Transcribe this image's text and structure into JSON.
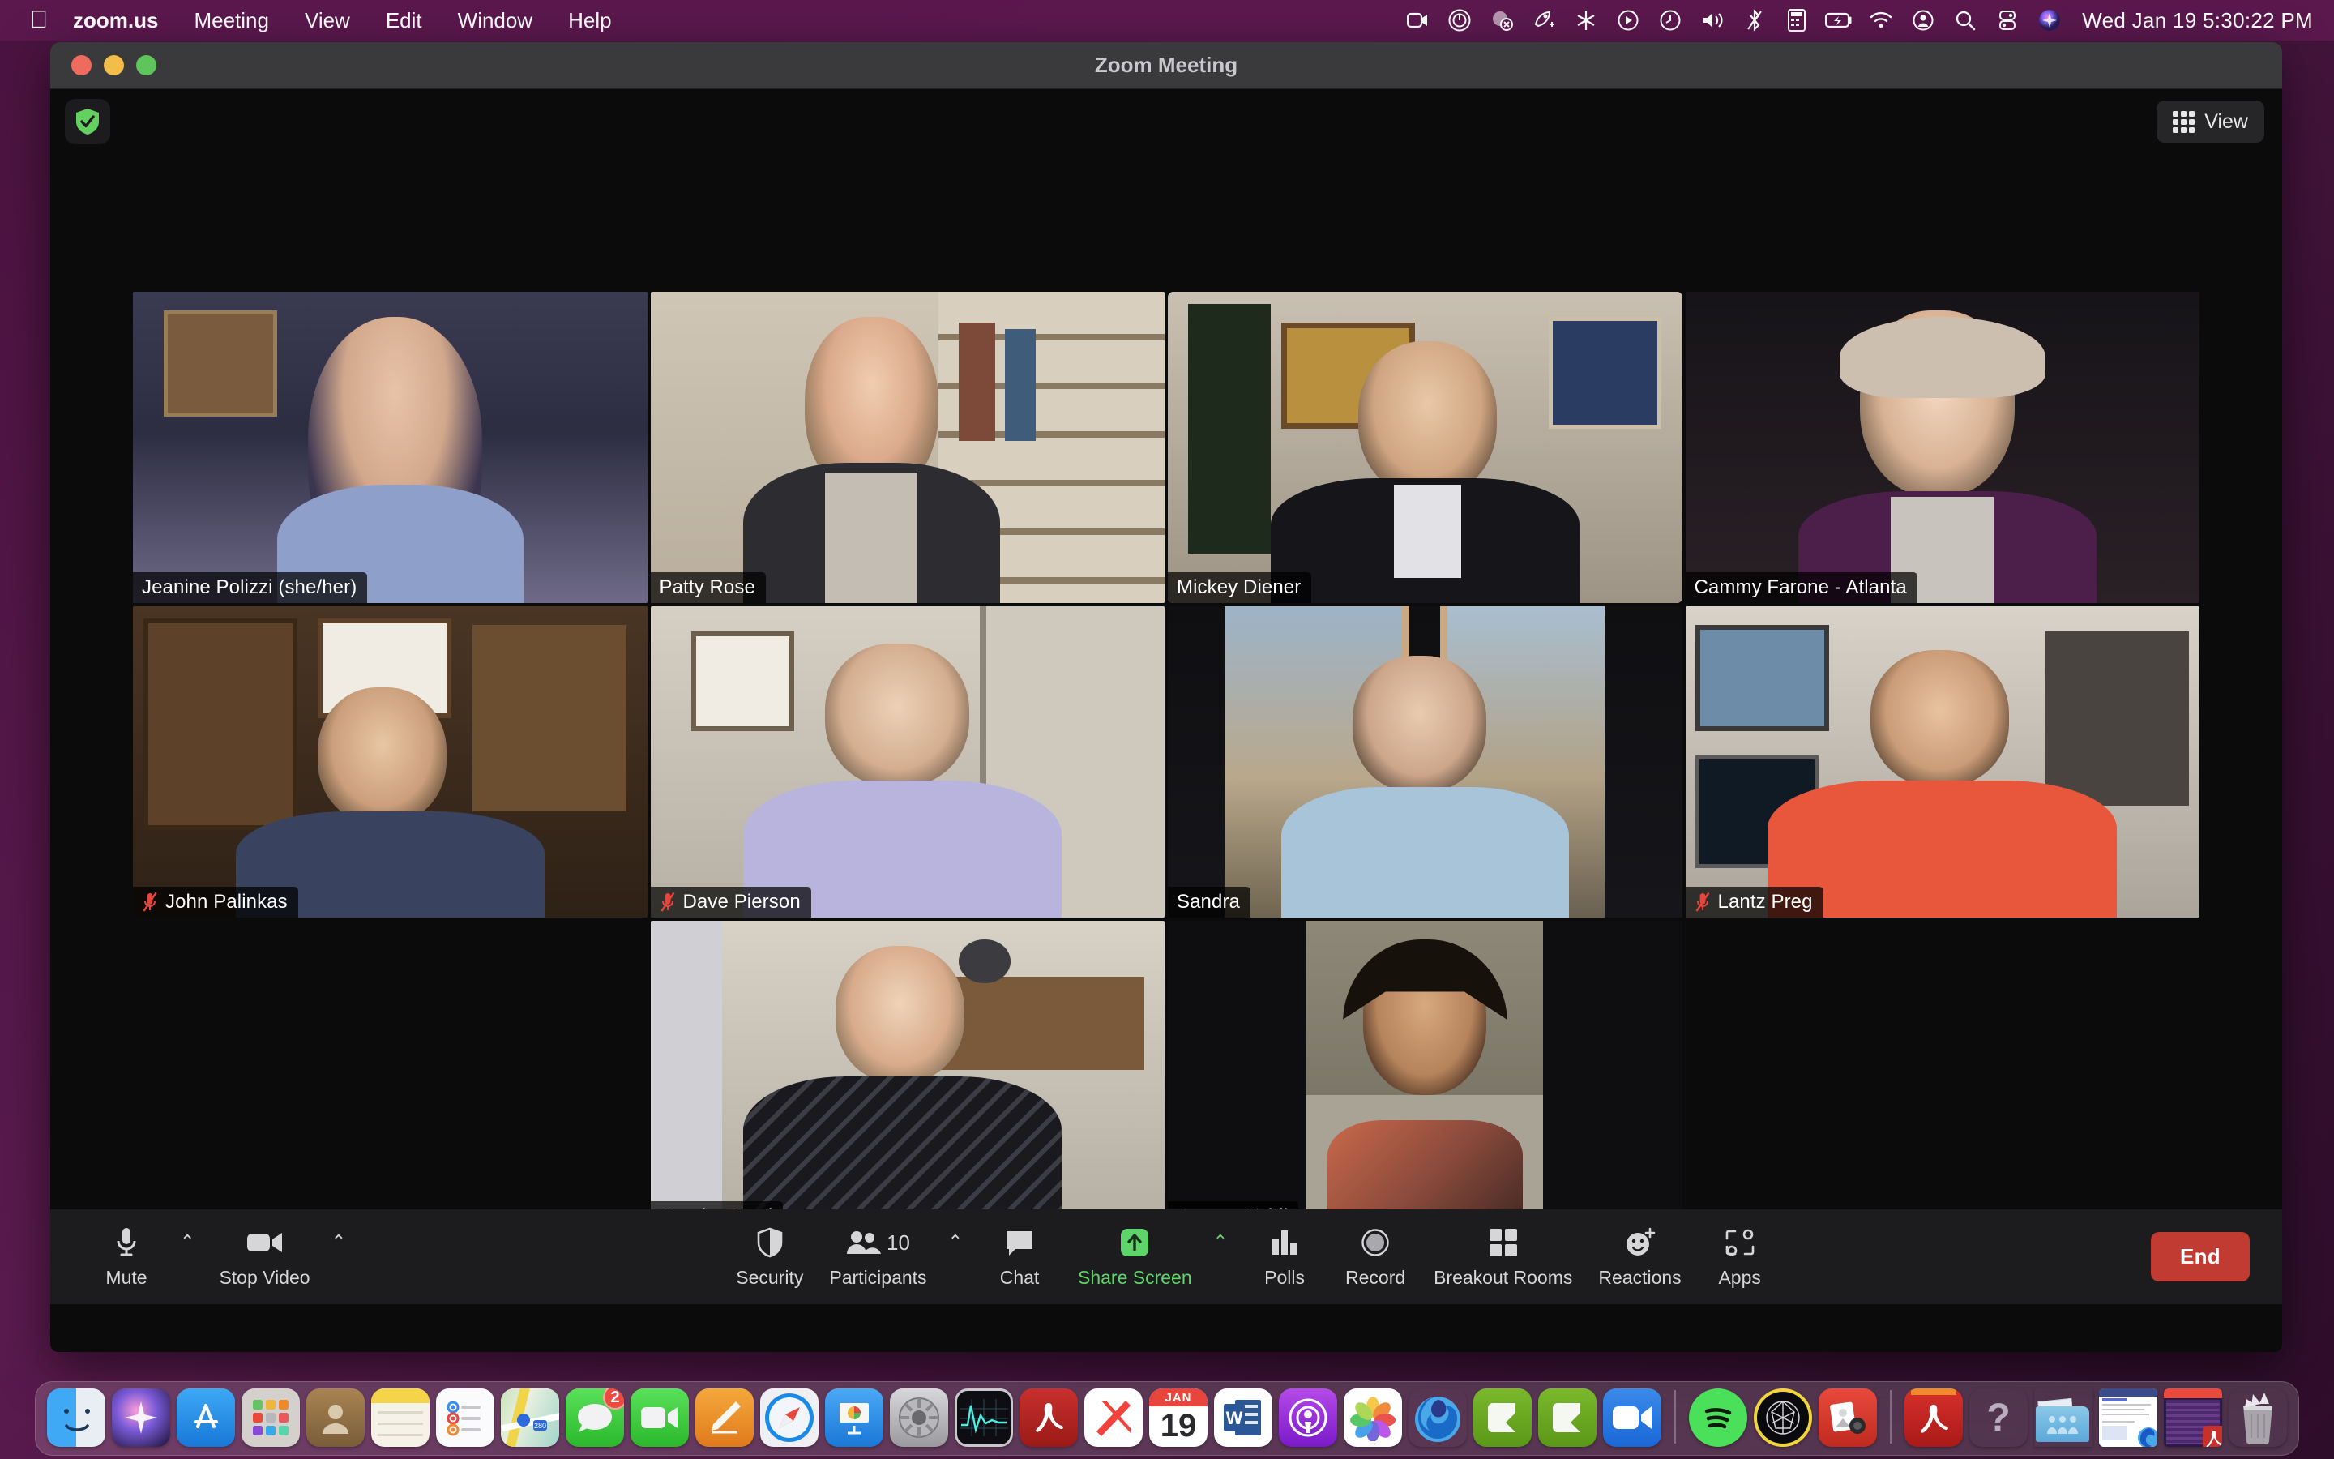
{
  "menubar": {
    "apple_icon": "apple-logo-icon",
    "items": [
      {
        "label": "zoom.us",
        "bold": true
      },
      {
        "label": "Meeting",
        "bold": false
      },
      {
        "label": "View",
        "bold": false
      },
      {
        "label": "Edit",
        "bold": false
      },
      {
        "label": "Window",
        "bold": false
      },
      {
        "label": "Help",
        "bold": false
      }
    ],
    "status_icons": [
      "screen-recording-icon",
      "zoom-record-circle-icon",
      "do-not-disturb-icon",
      "rocket-icon",
      "snowflake-icon",
      "play-circle-icon",
      "time-machine-icon",
      "volume-icon",
      "bluetooth-off-icon",
      "calculator-icon",
      "battery-charging-icon",
      "wifi-icon",
      "user-account-icon",
      "search-icon",
      "control-center-icon",
      "siri-icon"
    ],
    "clock": "Wed Jan 19 5:30:22 PM"
  },
  "window": {
    "title": "Zoom Meeting",
    "encryption_badge": "shield-check-icon",
    "view_button": {
      "label": "View",
      "icon": "grid-view-icon"
    }
  },
  "participants": [
    {
      "name": "Jeanine Polizzi (she/her)",
      "muted": false,
      "active_speaker": false,
      "row": 1
    },
    {
      "name": "Patty Rose",
      "muted": false,
      "active_speaker": false,
      "row": 1
    },
    {
      "name": "Mickey Diener",
      "muted": false,
      "active_speaker": true,
      "row": 1
    },
    {
      "name": "Cammy Farone - Atlanta",
      "muted": false,
      "active_speaker": false,
      "row": 1
    },
    {
      "name": "John Palinkas",
      "muted": true,
      "active_speaker": false,
      "row": 2
    },
    {
      "name": "Dave Pierson",
      "muted": true,
      "active_speaker": false,
      "row": 2
    },
    {
      "name": "Sandra",
      "muted": false,
      "active_speaker": false,
      "row": 2
    },
    {
      "name": "Lantz Preg",
      "muted": true,
      "active_speaker": false,
      "row": 2
    },
    {
      "name": "Carolyn Byrd",
      "muted": false,
      "active_speaker": false,
      "row": 3
    },
    {
      "name": "Seema Kohli",
      "muted": false,
      "active_speaker": false,
      "row": 3
    }
  ],
  "toolbar": {
    "mute": {
      "label": "Mute",
      "icon": "microphone-icon",
      "caret": "⌃"
    },
    "video": {
      "label": "Stop Video",
      "icon": "video-camera-icon",
      "caret": "⌃"
    },
    "security": {
      "label": "Security",
      "icon": "shield-icon"
    },
    "participants": {
      "label": "Participants",
      "icon": "people-icon",
      "count": "10",
      "caret": "⌃"
    },
    "chat": {
      "label": "Chat",
      "icon": "speech-bubble-icon"
    },
    "share": {
      "label": "Share Screen",
      "icon": "share-arrow-up-icon",
      "caret": "⌃",
      "color": "#5fd46a"
    },
    "polls": {
      "label": "Polls",
      "icon": "bar-chart-icon"
    },
    "record": {
      "label": "Record",
      "icon": "record-circle-icon"
    },
    "breakout": {
      "label": "Breakout Rooms",
      "icon": "four-squares-icon"
    },
    "reactions": {
      "label": "Reactions",
      "icon": "smiley-plus-icon"
    },
    "apps": {
      "label": "Apps",
      "icon": "apps-bracket-icon"
    },
    "end": {
      "label": "End",
      "color": "#c23b33"
    }
  },
  "dock": {
    "items": [
      {
        "name": "finder-icon",
        "running": true
      },
      {
        "name": "siri-icon",
        "running": false
      },
      {
        "name": "app-store-icon",
        "running": false
      },
      {
        "name": "launchpad-icon",
        "running": false
      },
      {
        "name": "contacts-icon",
        "running": false
      },
      {
        "name": "notes-icon",
        "running": false
      },
      {
        "name": "reminders-icon",
        "running": false
      },
      {
        "name": "maps-icon",
        "running": false
      },
      {
        "name": "messages-icon",
        "running": true,
        "badge": "2"
      },
      {
        "name": "facetime-icon",
        "running": false
      },
      {
        "name": "pages-icon",
        "running": false
      },
      {
        "name": "safari-icon",
        "running": false
      },
      {
        "name": "keynote-icon",
        "running": false
      },
      {
        "name": "system-preferences-icon",
        "running": true
      },
      {
        "name": "activity-monitor-icon",
        "running": false
      },
      {
        "name": "acrobat-reader-icon",
        "running": false
      },
      {
        "name": "news-icon",
        "running": false
      },
      {
        "name": "calendar-icon",
        "running": false,
        "month": "JAN",
        "day": "19"
      },
      {
        "name": "microsoft-word-icon",
        "running": false
      },
      {
        "name": "podcasts-icon",
        "running": false
      },
      {
        "name": "photos-icon",
        "running": false
      },
      {
        "name": "firefox-icon",
        "running": true
      },
      {
        "name": "camtasia-icon",
        "running": false
      },
      {
        "name": "camtasia-2-icon",
        "running": false
      },
      {
        "name": "zoom-app-icon",
        "running": true
      },
      {
        "name": "spotify-icon",
        "running": true
      },
      {
        "name": "dj-app-icon",
        "running": false
      },
      {
        "name": "snagit-icon",
        "running": false
      },
      {
        "name": "acrobat-pro-icon",
        "running": false
      },
      {
        "name": "help-icon",
        "running": false
      },
      {
        "name": "documents-folder-icon",
        "running": false
      },
      {
        "name": "minimized-browser-window-icon",
        "running": false
      },
      {
        "name": "minimized-pdf-window-icon",
        "running": false
      },
      {
        "name": "trash-icon",
        "running": false
      }
    ]
  }
}
